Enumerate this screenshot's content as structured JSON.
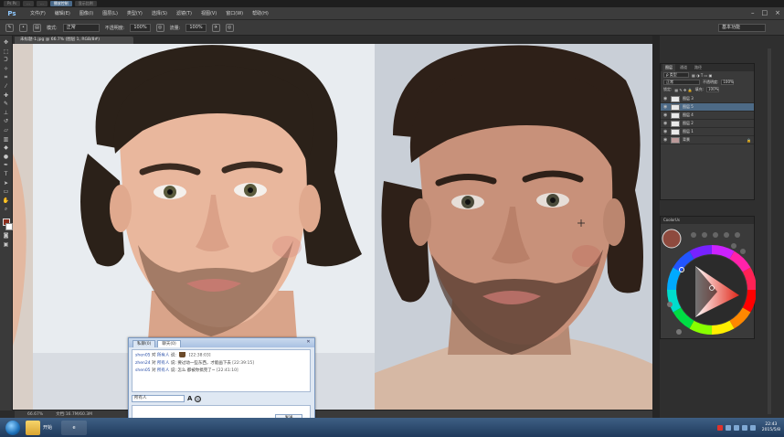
{
  "titlebar": {
    "tabs": [
      "Ps Ps",
      "...",
      "...",
      "播放控制",
      "显示比例"
    ]
  },
  "menubar": {
    "logo": "Ps",
    "items": [
      "文件(F)",
      "编辑(E)",
      "图像(I)",
      "图层(L)",
      "类型(Y)",
      "选择(S)",
      "滤镜(T)",
      "视图(V)",
      "窗口(W)",
      "帮助(H)"
    ],
    "window_controls": [
      "–",
      "□",
      "×"
    ]
  },
  "options": {
    "mode_label": "模式:",
    "mode_value": "正常",
    "opacity_label": "不透明度:",
    "opacity_value": "100%",
    "flow_label": "流量:",
    "flow_value": "100%",
    "workspace": "基本功能"
  },
  "document": {
    "tab": "未标题-1.jpg @ 66.7% (图层 1, RGB/8#)"
  },
  "status": {
    "zoom": "66.67%",
    "doc": "文档:16.7M/60.3M"
  },
  "layers_panel": {
    "tabs": [
      "图层",
      "通道",
      "路径"
    ],
    "blend_mode": "正常",
    "opacity_label": "不透明度:",
    "opacity_value": "100%",
    "lock_label": "锁定:",
    "fill_label": "填充:",
    "fill_value": "100%",
    "layers": [
      {
        "name": "图层 3",
        "active": false
      },
      {
        "name": "图层 5",
        "active": true
      },
      {
        "name": "图层 4",
        "active": false
      },
      {
        "name": "图层 2",
        "active": false
      },
      {
        "name": "图层 1",
        "active": false
      },
      {
        "name": "背景",
        "active": false
      }
    ]
  },
  "colors": {
    "foreground": "#8b2e1e",
    "kuler_swatch": "#8e4a3e",
    "selection_blue": "#4d6a86"
  },
  "kuler": {
    "title": "CoolorUs"
  },
  "chat": {
    "tabs": [
      "私聊(0)",
      "聊天(0)"
    ],
    "messages": [
      {
        "user": "shen05",
        "verb": "对",
        "to": "所有人",
        "says": "说:",
        "text": "",
        "time": "[22:38:03]",
        "has_emoji": true
      },
      {
        "user": "zhen24",
        "verb": "对",
        "to": "所有人",
        "says": "说:",
        "text": "要过动一些东西，才能画下去",
        "time": "[22:39:15]",
        "has_emoji": false
      },
      {
        "user": "shen05",
        "verb": "对",
        "to": "所有人",
        "says": "说:",
        "text": "怎么 都被你搞完了~",
        "time": "[22:41:10]",
        "has_emoji": false
      }
    ],
    "target": "所有人",
    "send_label": "发送"
  },
  "taskbar": {
    "start_label": "开始",
    "tasks": [
      ""
    ],
    "clock_time": "22:43",
    "clock_date": "2015/5/8"
  }
}
